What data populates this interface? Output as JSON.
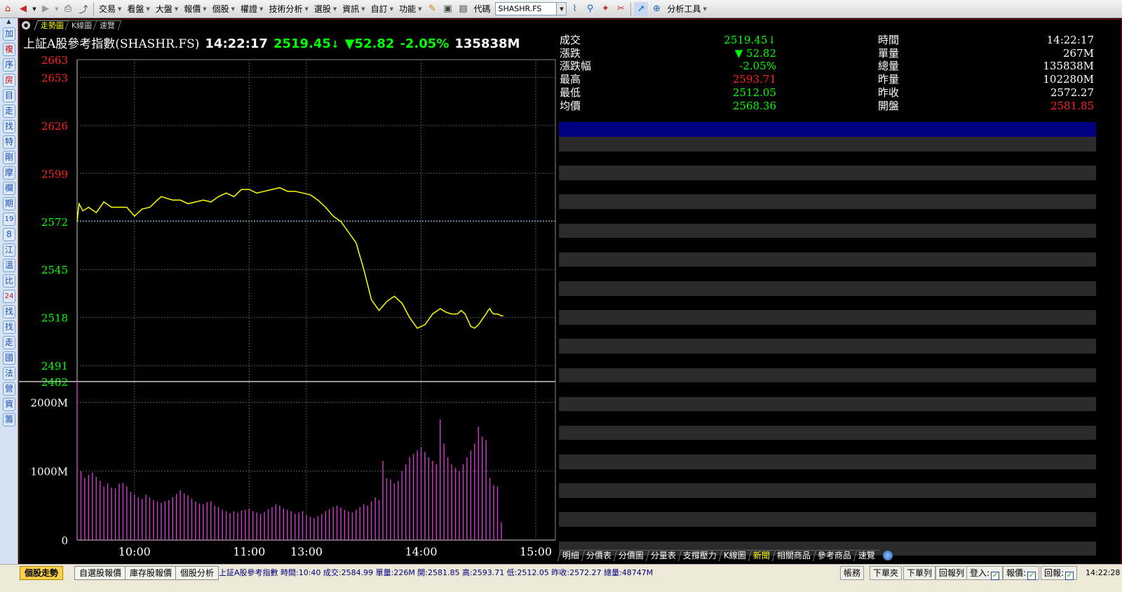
{
  "toolbar": {
    "menus": [
      "交易",
      "看盤",
      "大盤",
      "報價",
      "個股",
      "權證",
      "技術分析",
      "選股",
      "資訊",
      "自訂",
      "功能"
    ],
    "code_label": "代碼",
    "code_value": "SHASHR.FS",
    "analysis_tools": "分析工具"
  },
  "sidebar": {
    "items": [
      "加",
      "複",
      "序",
      "房",
      "目",
      "走",
      "找",
      "特",
      "剛",
      "摩",
      "欄",
      "期",
      "19",
      "8",
      "江",
      "溫",
      "比",
      "24",
      "找",
      "找",
      "走",
      "國",
      "法",
      "營",
      "資",
      "籌"
    ]
  },
  "chart_tabs": [
    "走勢圖",
    "K線圖",
    "速覽"
  ],
  "header": {
    "name": "上証A股參考指數(SHASHR.FS)",
    "time": "14:22:17",
    "price": "2519.45",
    "arrow": "↓",
    "change": "▼52.82",
    "percent": "-2.05%",
    "volume": "135838M"
  },
  "quote": {
    "left": [
      {
        "label": "成交",
        "value": "2519.45↓",
        "color": "#00ff00"
      },
      {
        "label": "漲跌",
        "value": "▼ 52.82",
        "color": "#00ff00"
      },
      {
        "label": "漲跌幅",
        "value": "-2.05%",
        "color": "#00ff00"
      },
      {
        "label": "最高",
        "value": "2593.71",
        "color": "#ff2020"
      },
      {
        "label": "最低",
        "value": "2512.05",
        "color": "#00ff00"
      },
      {
        "label": "均價",
        "value": "2568.36",
        "color": "#00ff00"
      }
    ],
    "right": [
      {
        "label": "時間",
        "value": "14:22:17",
        "color": "#ffffff"
      },
      {
        "label": "單量",
        "value": "267M",
        "color": "#ffffff"
      },
      {
        "label": "總量",
        "value": "135838M",
        "color": "#ffffff"
      },
      {
        "label": "昨量",
        "value": "102280M",
        "color": "#ffffff"
      },
      {
        "label": "昨收",
        "value": "2572.27",
        "color": "#ffffff"
      },
      {
        "label": "開盤",
        "value": "2581.85",
        "color": "#ff2020"
      }
    ]
  },
  "chart_data": {
    "type": "line",
    "price_ticks": [
      {
        "label": "2663",
        "value": 2663,
        "color": "#ff2020"
      },
      {
        "label": "2653",
        "value": 2653,
        "color": "#ff2020"
      },
      {
        "label": "2626",
        "value": 2626,
        "color": "#ff2020"
      },
      {
        "label": "2599",
        "value": 2599,
        "color": "#ff2020"
      },
      {
        "label": "2572",
        "value": 2572,
        "color": "#00ff00"
      },
      {
        "label": "2545",
        "value": 2545,
        "color": "#00ff00"
      },
      {
        "label": "2518",
        "value": 2518,
        "color": "#00ff00"
      },
      {
        "label": "2491",
        "value": 2491,
        "color": "#00ff00"
      },
      {
        "label": "2482",
        "value": 2482,
        "color": "#00ff00"
      }
    ],
    "price_ylim": [
      2482,
      2663
    ],
    "prev_close": 2572.27,
    "volume_ticks": [
      {
        "label": "2000M",
        "value": 2000
      },
      {
        "label": "1000M",
        "value": 1000
      },
      {
        "label": "0",
        "value": 0
      }
    ],
    "volume_ylim": [
      0,
      2300
    ],
    "time_ticks": [
      {
        "label": "10:00",
        "minute": 30
      },
      {
        "label": "11:00",
        "minute": 90
      },
      {
        "label": "13:00",
        "minute": 120
      },
      {
        "label": "14:00",
        "minute": 180
      },
      {
        "label": "15:00",
        "minute": 240
      }
    ],
    "session_minutes": 240,
    "price_series": {
      "minute": [
        0,
        1,
        3,
        6,
        10,
        14,
        18,
        22,
        26,
        30,
        34,
        38,
        42,
        44,
        47,
        50,
        54,
        58,
        62,
        66,
        70,
        74,
        78,
        82,
        86,
        90,
        94,
        98,
        102,
        106,
        110,
        114,
        118,
        122,
        126,
        130,
        134,
        138,
        142,
        146,
        150,
        154,
        158,
        162,
        166,
        170,
        174,
        178,
        182,
        186,
        190,
        193,
        196,
        199,
        200,
        201,
        203,
        206,
        208,
        210,
        212,
        214,
        215,
        216,
        217,
        218,
        220,
        222,
        223
      ],
      "price": [
        2572,
        2582,
        2578,
        2580,
        2577,
        2583,
        2580,
        2580,
        2580,
        2575,
        2579,
        2580,
        2584,
        2586,
        2585,
        2584,
        2584,
        2582,
        2583,
        2584,
        2583,
        2586,
        2588,
        2586,
        2590,
        2590,
        2588,
        2589,
        2590,
        2591,
        2589,
        2589,
        2588,
        2587,
        2584,
        2580,
        2575,
        2572,
        2566,
        2560,
        2545,
        2528,
        2522,
        2527,
        2530,
        2526,
        2518,
        2512,
        2514,
        2520,
        2523,
        2521,
        2520,
        2520,
        2521,
        2522,
        2520,
        2513,
        2512,
        2514,
        2517,
        2520,
        2522,
        2523,
        2521,
        2520,
        2520,
        2519,
        2519
      ]
    },
    "volume_series": {
      "minute": [
        0,
        2,
        4,
        6,
        8,
        10,
        12,
        14,
        16,
        18,
        20,
        22,
        24,
        26,
        28,
        30,
        32,
        34,
        36,
        38,
        40,
        42,
        44,
        46,
        48,
        50,
        52,
        54,
        56,
        58,
        60,
        62,
        64,
        66,
        68,
        70,
        72,
        74,
        76,
        78,
        80,
        82,
        84,
        86,
        88,
        90,
        92,
        94,
        96,
        98,
        100,
        102,
        104,
        106,
        108,
        110,
        112,
        114,
        116,
        118,
        120,
        122,
        124,
        126,
        128,
        130,
        132,
        134,
        136,
        138,
        140,
        142,
        144,
        146,
        148,
        150,
        152,
        154,
        156,
        158,
        160,
        162,
        164,
        166,
        168,
        170,
        172,
        174,
        176,
        178,
        180,
        182,
        184,
        186,
        188,
        190,
        192,
        194,
        196,
        198,
        200,
        202,
        204,
        206,
        208,
        210,
        212,
        214,
        216,
        218,
        220,
        222
      ],
      "volume": [
        2300,
        1000,
        900,
        950,
        980,
        920,
        860,
        780,
        820,
        760,
        750,
        820,
        830,
        780,
        700,
        660,
        620,
        600,
        660,
        620,
        580,
        560,
        540,
        560,
        580,
        620,
        670,
        720,
        680,
        650,
        600,
        560,
        530,
        520,
        550,
        560,
        500,
        480,
        440,
        420,
        390,
        420,
        400,
        430,
        440,
        460,
        420,
        400,
        380,
        410,
        450,
        480,
        520,
        500,
        460,
        440,
        420,
        380,
        400,
        420,
        360,
        340,
        320,
        350,
        380,
        420,
        450,
        480,
        500,
        470,
        440,
        420,
        400,
        440,
        480,
        520,
        500,
        560,
        620,
        580,
        1150,
        900,
        880,
        820,
        860,
        1000,
        1100,
        1200,
        1250,
        1300,
        1350,
        1280,
        1200,
        1150,
        1100,
        1750,
        1400,
        1200,
        1100,
        1050,
        1000,
        1100,
        1200,
        1300,
        1400,
        1650,
        1500,
        1450,
        900,
        800,
        780,
        260
      ]
    }
  },
  "right_tabs": [
    "明細",
    "分價表",
    "分價圖",
    "分量表",
    "支撐壓力",
    "K線圖",
    "新聞",
    "相關商品",
    "參考商品",
    "速覽"
  ],
  "right_tabs_active": "新聞",
  "status": {
    "tabs": [
      "個股走勢",
      "自選股報價",
      "庫存股報價",
      "個股分析"
    ],
    "text": "上証A股參考指數 時間:10:40 成交:2584.99 單量:226M 開:2581.85 高:2593.71 低:2512.05 昨收:2572.27 總量:48747M",
    "buttons": [
      "帳務",
      "下單夾",
      "下單列",
      "回報列"
    ],
    "checks": [
      "登入:",
      "報價:",
      "回報:"
    ],
    "clock": "14:22:28"
  }
}
